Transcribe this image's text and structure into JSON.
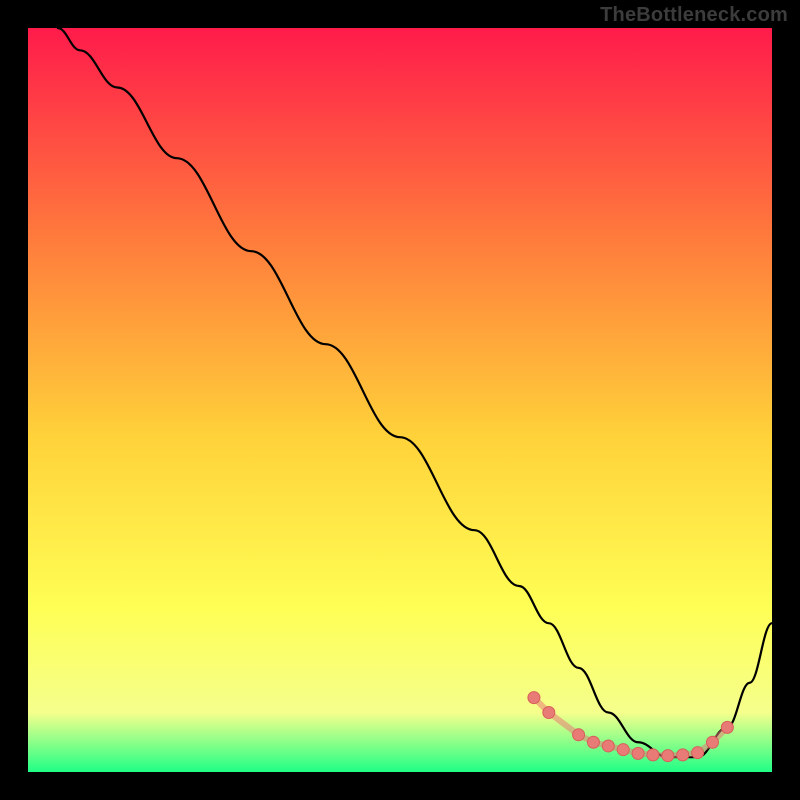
{
  "watermark": {
    "text": "TheBottleneck.com"
  },
  "colors": {
    "frame_bg": "#000000",
    "curve": "#000000",
    "marker_fill": "#e97b76",
    "marker_stroke": "#d65f5a",
    "gradient_top": "#ff1b4b",
    "gradient_mid1": "#ff7a3c",
    "gradient_mid2": "#ffd23a",
    "gradient_mid3": "#ffff55",
    "gradient_mid4": "#f5ff8c",
    "gradient_bottom": "#20ff86"
  },
  "chart_data": {
    "type": "line",
    "title": "",
    "xlabel": "",
    "ylabel": "",
    "xlim": [
      0,
      100
    ],
    "ylim": [
      0,
      100
    ],
    "grid": false,
    "legend": false,
    "series": [
      {
        "name": "curve",
        "x": [
          4,
          7,
          12,
          20,
          30,
          40,
          50,
          60,
          66,
          70,
          74,
          78,
          82,
          86,
          90,
          94,
          97,
          100
        ],
        "y": [
          100,
          97,
          92,
          82.5,
          70,
          57.5,
          45,
          32.5,
          25,
          20,
          14,
          8,
          4,
          2,
          2,
          6,
          12,
          20
        ]
      }
    ],
    "markers": {
      "name": "highlight-points",
      "x": [
        68,
        70,
        74,
        76,
        78,
        80,
        82,
        84,
        86,
        88,
        90,
        92,
        94
      ],
      "y": [
        10,
        8,
        5,
        4,
        3.5,
        3,
        2.5,
        2.3,
        2.2,
        2.3,
        2.6,
        4,
        6
      ]
    }
  }
}
